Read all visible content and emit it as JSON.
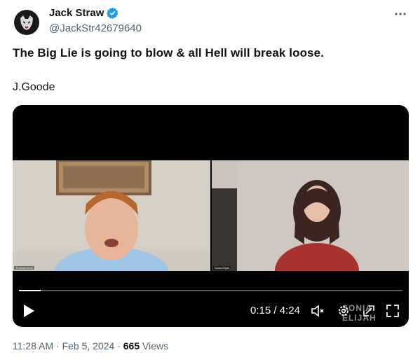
{
  "tweet": {
    "author_name": "Jack Straw",
    "author_handle": "@JackStr42679640",
    "text": "The Big Lie is going to blow & all Hell will break loose.",
    "signature": "J.Goode",
    "time": "11:28 AM",
    "separator": "·",
    "date": "Feb 5, 2024",
    "views_count": "665",
    "views_label": "Views"
  },
  "video": {
    "current_time": "0:15",
    "duration": "4:24",
    "time_separator": "/",
    "progress": 0.057,
    "watermark": "SONIA ELIJAH",
    "left_caption": "Thomas Renz",
    "right_caption": "Sonia Elijah",
    "icons": [
      "play-icon",
      "mute-icon",
      "settings-icon",
      "pip-icon",
      "fullscreen-icon"
    ]
  },
  "colors": {
    "accent": "#1d9bf0",
    "text": "#0f1419",
    "muted": "#536471"
  }
}
